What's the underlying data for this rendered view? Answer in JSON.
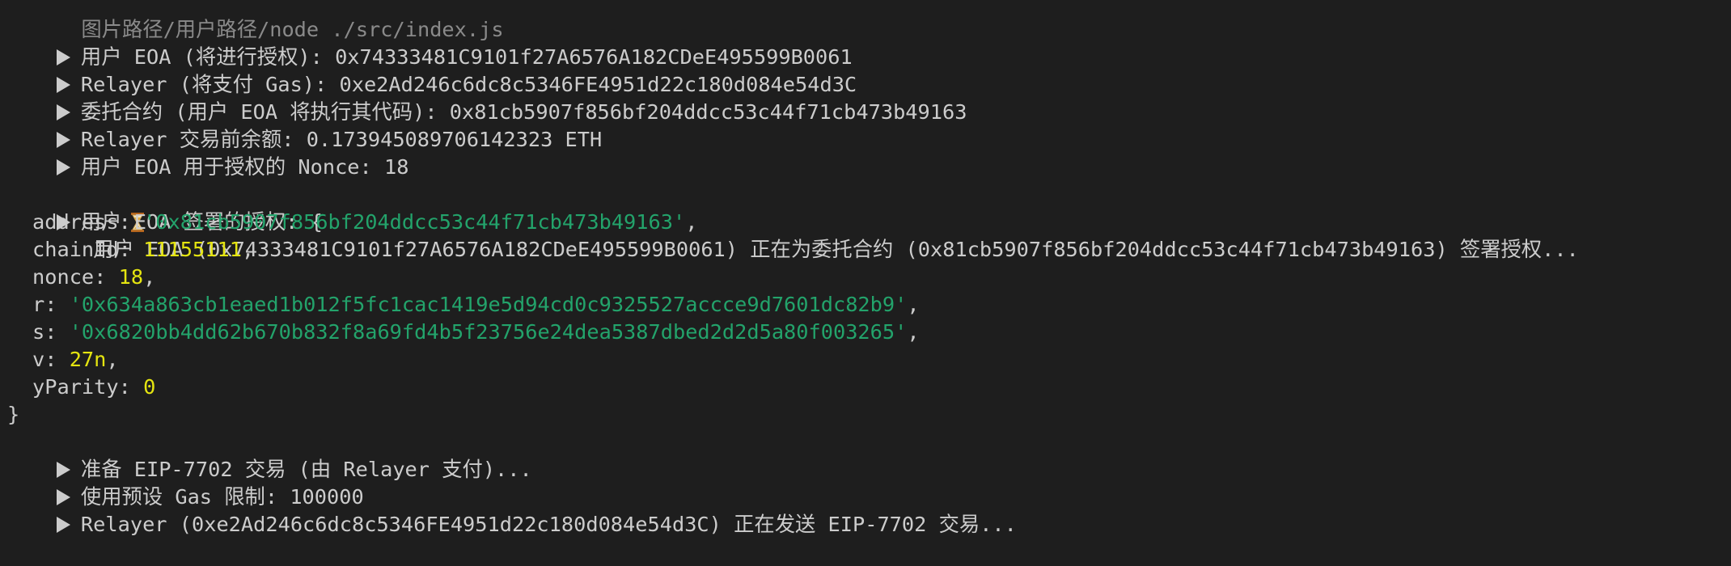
{
  "top_partial": "  图片路径/用户路径/node ./src/index.js",
  "log_lines": [
    {
      "text": "用户 EOA (将进行授权): 0x74333481C9101f27A6576A182CDeE495599B0061"
    },
    {
      "text": "Relayer (将支付 Gas): 0xe2Ad246c6dc8c5346FE4951d22c180d084e54d3C"
    },
    {
      "text": "委托合约 (用户 EOA 将执行其代码): 0x81cb5907f856bf204ddcc53c44f71cb473b49163"
    },
    {
      "text": "Relayer 交易前余额: 0.173945089706142323 ETH"
    },
    {
      "text": "用户 EOA 用于授权的 Nonce: 18"
    }
  ],
  "signing_line": {
    "icon": "hourglass-icon",
    "text": " 用户 EOA (0x74333481C9101f27A6576A182CDeE495599B0061) 正在为委托合约 (0x81cb5907f856bf204ddcc53c44f71cb473b49163) 签署授权..."
  },
  "auth_header": "用户 EOA 签署的授权: {",
  "auth": {
    "address_key": "address: ",
    "address_val": "'0x81cb5907f856bf204ddcc53c44f71cb473b49163'",
    "chainId_key": "chainId: ",
    "chainId_val": "11155111",
    "nonce_key": "nonce: ",
    "nonce_val": "18",
    "r_key": "r: ",
    "r_val": "'0x634a863cb1eaed1b012f5fc1cac1419e5d94cd0c9325527accce9d7601dc82b9'",
    "s_key": "s: ",
    "s_val": "'0x6820bb4dd62b670b832f8a69fd4b5f23756e24dea5387dbed2d2d5a80f003265'",
    "v_key": "v: ",
    "v_val": "27n",
    "yParity_key": "yParity: ",
    "yParity_val": "0",
    "comma": ","
  },
  "close_brace": "}",
  "tail_lines": [
    {
      "text": "准备 EIP-7702 交易 (由 Relayer 支付)..."
    },
    {
      "text": "使用预设 Gas 限制: 100000"
    },
    {
      "text": "Relayer (0xe2Ad246c6dc8c5346FE4951d22c180d084e54d3C) 正在发送 EIP-7702 交易..."
    }
  ],
  "colors": {
    "background": "#1e1e1e",
    "text": "#cccccc",
    "string": "#23a36b",
    "number": "#e5e510"
  }
}
